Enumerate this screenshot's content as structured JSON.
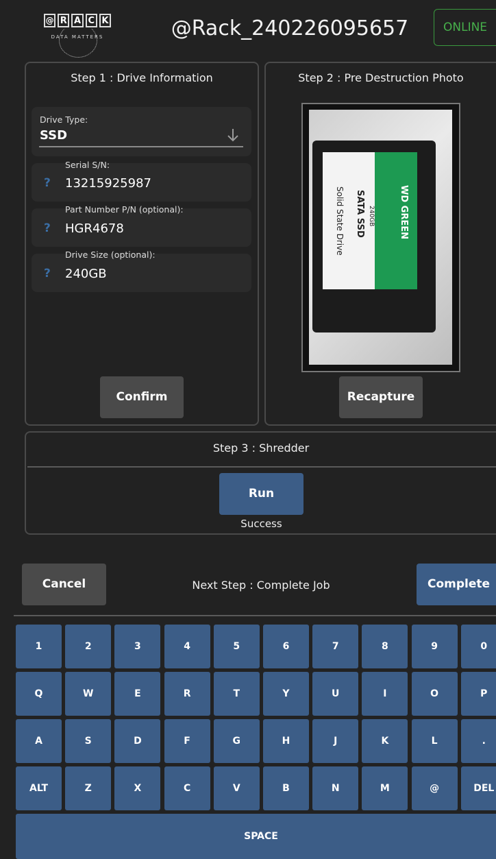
{
  "header": {
    "logo_text": "@RACK",
    "logo_tagline": "DATA MATTERS",
    "job_title": "@Rack_240226095657",
    "status": "ONLINE"
  },
  "step1": {
    "title": "Step 1 : Drive Information",
    "drive_type_label": "Drive Type:",
    "drive_type_value": "SSD",
    "serial_label": "Serial S/N:",
    "serial_value": "13215925987",
    "part_label": "Part Number P/N (optional):",
    "part_value": "HGR4678",
    "size_label": "Drive Size (optional):",
    "size_value": "240GB",
    "help_icon": "?",
    "confirm_label": "Confirm"
  },
  "step2": {
    "title": "Step 2 : Pre Destruction Photo",
    "recapture_label": "Recapture",
    "photo_text": [
      "WD GREEN",
      "SATA SSD",
      "240GB",
      "Solid State Drive"
    ]
  },
  "step3": {
    "title": "Step 3 : Shredder",
    "run_label": "Run",
    "status": "Success"
  },
  "footer": {
    "cancel_label": "Cancel",
    "next_step": "Next Step : Complete Job",
    "complete_label": "Complete"
  },
  "keyboard": {
    "rows": [
      [
        "1",
        "2",
        "3",
        "4",
        "5",
        "6",
        "7",
        "8",
        "9",
        "0"
      ],
      [
        "Q",
        "W",
        "E",
        "R",
        "T",
        "Y",
        "U",
        "I",
        "O",
        "P"
      ],
      [
        "A",
        "S",
        "D",
        "F",
        "G",
        "H",
        "J",
        "K",
        "L",
        "."
      ],
      [
        "ALT",
        "Z",
        "X",
        "C",
        "V",
        "B",
        "N",
        "M",
        "@",
        "DEL"
      ]
    ],
    "space_label": "SPACE"
  },
  "colors": {
    "accent": "#3c5d87",
    "online": "#47b04b",
    "background": "#222222"
  },
  "icons": {
    "dropdown": "arrow-down-icon",
    "help": "question-icon"
  }
}
